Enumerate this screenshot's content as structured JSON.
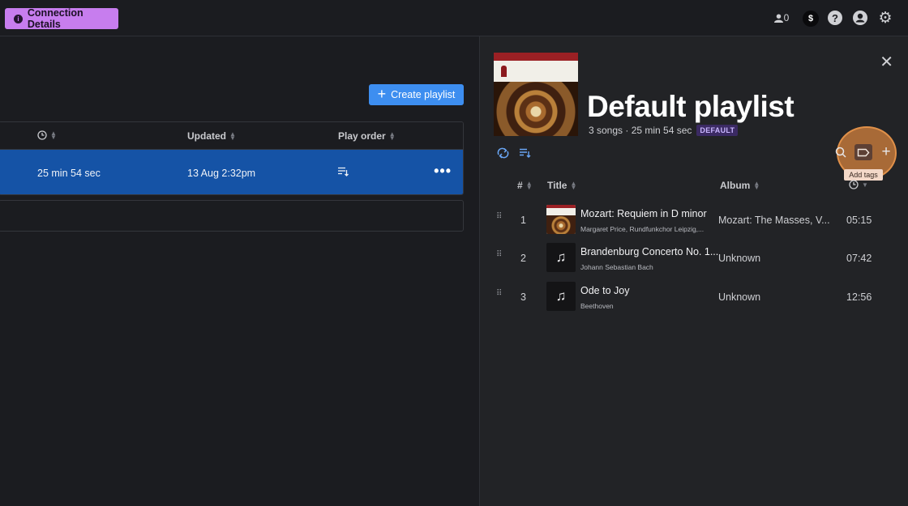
{
  "topbar": {
    "connection_label": "Connection Details",
    "user_count": "0",
    "dollar_symbol": "$",
    "help_symbol": "?"
  },
  "library": {
    "create_label": "Create playlist",
    "columns": [
      "Updated",
      "Play order"
    ],
    "row": {
      "duration": "25 min 54 sec",
      "updated": "13 Aug 2:32pm",
      "more_label": "•••"
    }
  },
  "playlist": {
    "title": "Default playlist",
    "meta": "3 songs · 25 min 54 sec",
    "badge": "DEFAULT",
    "tooltip": "Add tags",
    "columns": {
      "number": "#",
      "title": "Title",
      "album": "Album"
    },
    "songs": [
      {
        "number": "1",
        "title": "Mozart: Requiem in D minor",
        "artist": "Margaret Price, Rundfunkchor Leipzig,...",
        "album": "Mozart: The Masses, V...",
        "duration": "05:15"
      },
      {
        "number": "2",
        "title": "Brandenburg Concerto No. 1...",
        "artist": "Johann Sebastian Bach",
        "album": "Unknown",
        "duration": "07:42"
      },
      {
        "number": "3",
        "title": "Ode to Joy",
        "artist": "Beethoven",
        "album": "Unknown",
        "duration": "12:56"
      }
    ]
  },
  "colors": {
    "accent_purple": "#c77dee",
    "accent_blue": "#3d8ef0",
    "selected_row": "#1553a6",
    "highlight_orange": "#d6833d"
  },
  "icons": [
    "info-icon",
    "user-icon",
    "dollar-icon",
    "help-icon",
    "account-icon",
    "settings-icon",
    "plus-icon",
    "clock-icon",
    "play-order-icon",
    "more-icon",
    "close-icon",
    "shuffle-icon",
    "sort-icon",
    "search-icon",
    "tag-icon",
    "drag-handle-icon",
    "music-note-icon"
  ]
}
